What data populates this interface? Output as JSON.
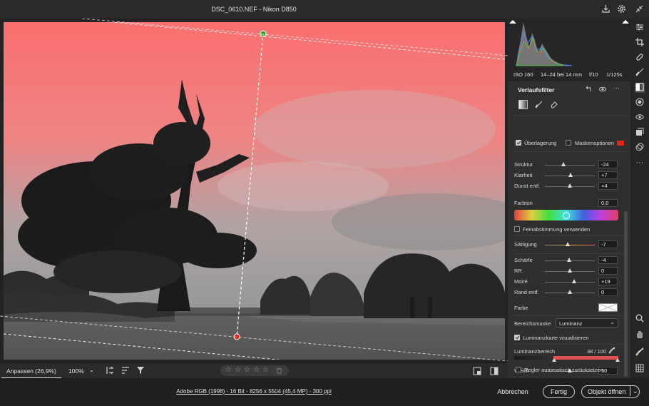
{
  "window": {
    "title": "DSC_0610.NEF - Nikon D850"
  },
  "topbar": {
    "icons": [
      "save-icon",
      "gear-icon",
      "collapse-icon"
    ]
  },
  "bottombar": {
    "view_mode": "Anpassen (26,9%)",
    "zoom": "100%",
    "zoom_arrow": "⌄",
    "rating_stars": 5,
    "trash_icon": "trash-icon"
  },
  "footer": {
    "file_info": "Adobe RGB (1998) - 16 Bit - 8256 x 5504 (45,4 MP) - 300 ppi",
    "cancel": "Abbrechen",
    "done": "Fertig",
    "open": "Objekt öffnen",
    "open_arrow": "⌄"
  },
  "camera": {
    "iso": "ISO 160",
    "lens": "14–24 bei 14 mm",
    "aperture": "f/10",
    "shutter": "1/125s"
  },
  "panel": {
    "title": "Verlaufsfilter",
    "overlay_label": "Überlagerung",
    "overlay_checked": true,
    "mask_options_label": "Maskenoptionen",
    "mask_color": "#e8201c",
    "sliders_top": [
      {
        "label": "Struktur",
        "value": "-24",
        "pos": 0.38
      },
      {
        "label": "Klarheit",
        "value": "+7",
        "pos": 0.53
      },
      {
        "label": "Dunst entf.",
        "value": "+4",
        "pos": 0.52
      }
    ],
    "hue": {
      "label": "Farbton",
      "value": "0,0"
    },
    "fine_tune_label": "Feinabstimmung verwenden",
    "saturation": {
      "label": "Sättigung",
      "value": "-7",
      "pos": 0.46
    },
    "sliders_detail": [
      {
        "label": "Schärfe",
        "value": "-4",
        "pos": 0.48
      },
      {
        "label": "RR",
        "value": "0",
        "pos": 0.5
      },
      {
        "label": "Moiré",
        "value": "+19",
        "pos": 0.59
      },
      {
        "label": "Rand entf.",
        "value": "0",
        "pos": 0.5
      }
    ],
    "color_label": "Farbe",
    "range_mask_label": "Bereichsmaske",
    "range_mask_value": "Luminanz",
    "range_mask_arrow": "⌄",
    "lum_map_label": "Luminanzkarte visualisieren",
    "lum_map_checked": true,
    "lum_range_label": "Luminanzbereich",
    "lum_range_value": "38 / 100",
    "soft_label": "Weich",
    "soft_value": "50",
    "soft_pos": 0.5,
    "auto_reset_label": "Regler automatisch zurücksetzen"
  },
  "rail": {
    "icons": [
      "sliders-icon",
      "crop-icon",
      "healing-icon",
      "brush-icon",
      "graduated-filter-icon",
      "radial-filter-icon",
      "red-eye-icon",
      "snapshots-icon",
      "presets-icon",
      "more-icon",
      "zoom-icon",
      "hand-icon",
      "eyedropper-icon",
      "grid-icon"
    ]
  }
}
